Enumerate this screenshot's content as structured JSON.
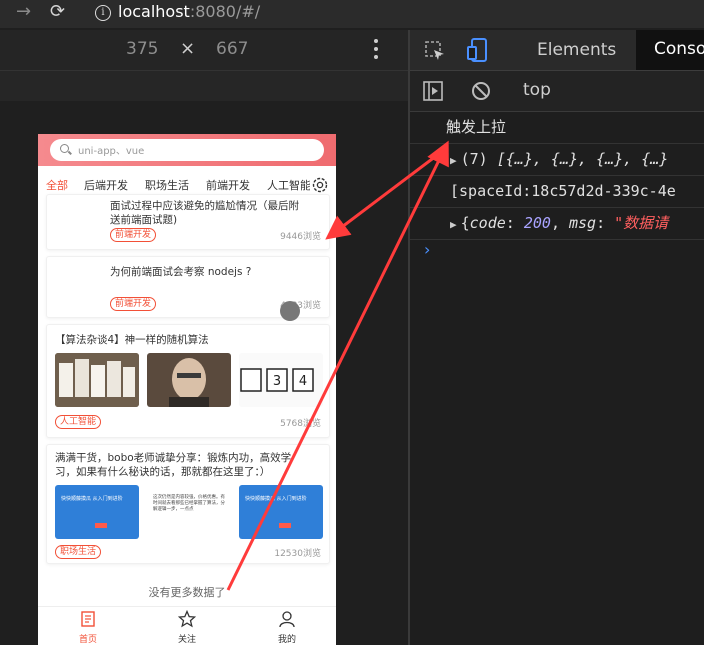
{
  "browser": {
    "url_host": "localhost",
    "url_rest": ":8080/#/"
  },
  "device_toolbar": {
    "width": "375",
    "separator": "×",
    "height": "667"
  },
  "search": {
    "placeholder": "uni-app、vue"
  },
  "tabs": [
    "全部",
    "后端开发",
    "职场生活",
    "前端开发",
    "人工智能"
  ],
  "cards": [
    {
      "title": "面试过程中应该避免的尴尬情况（最后附送前端面试题）",
      "title_visible": "面试过程中应该避免的尴尬情况（最后附\n送前端面试题)",
      "tag": "前端开发",
      "views": "9446浏览"
    },
    {
      "title": "为何前端面试会考察 nodejs ?",
      "tag": "前端开发",
      "views": "4583浏览"
    },
    {
      "title": "【算法杂谈4】神一样的随机算法",
      "tag": "人工智能",
      "views": "5768浏览"
    },
    {
      "title": "满满干货，bobo老师诚挚分享：锻炼内功，高效学习，如果有什么秘诀的话，那就都在这里了：）",
      "title_visible": "满满干货，bobo老师诚挚分享：锻炼内功，高效学\n习，如果有什么秘诀的话，那就都在这里了：）",
      "tag": "职场生活",
      "views": "12530浏览",
      "thumb_texts": [
        "快快顺藤摸瓜 从入门到进阶",
        "这次仍然是内容较强，价格优惠。有时间就去看那些已经掌握了算法，分解逻辑一步，一点点",
        "快快顺藤摸瓜 从入门到进阶"
      ]
    }
  ],
  "no_more": "没有更多数据了",
  "tabbar": [
    {
      "label": "首页",
      "icon": "home-icon",
      "active": true
    },
    {
      "label": "关注",
      "icon": "star-icon",
      "active": false
    },
    {
      "label": "我的",
      "icon": "user-icon",
      "active": false
    }
  ],
  "devtools": {
    "tabs": [
      "Elements",
      "Console"
    ],
    "context": "top",
    "console_lines": [
      {
        "text": "触发上拉"
      },
      {
        "prefix": "(7) ",
        "text": "[{…}, {…}, {…}, {…}"
      },
      {
        "text": "[spaceId:18c57d2d-339c-4e"
      },
      {
        "code_key": "code",
        "code_val": "200",
        "msg_key": "msg",
        "msg_val": "\"数据请"
      }
    ]
  },
  "colors": {
    "accent": "#f25037",
    "search_bg": "#ef6b6f",
    "arrow": "#ff3b3b"
  }
}
